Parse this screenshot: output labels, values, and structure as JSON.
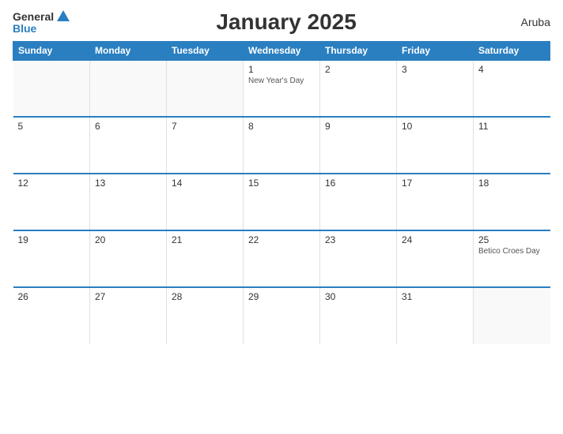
{
  "header": {
    "logo_general": "General",
    "logo_blue": "Blue",
    "title": "January 2025",
    "country": "Aruba"
  },
  "weekdays": [
    "Sunday",
    "Monday",
    "Tuesday",
    "Wednesday",
    "Thursday",
    "Friday",
    "Saturday"
  ],
  "weeks": [
    [
      {
        "day": "",
        "holiday": "",
        "empty": true
      },
      {
        "day": "",
        "holiday": "",
        "empty": true
      },
      {
        "day": "",
        "holiday": "",
        "empty": true
      },
      {
        "day": "1",
        "holiday": "New Year's Day",
        "empty": false
      },
      {
        "day": "2",
        "holiday": "",
        "empty": false
      },
      {
        "day": "3",
        "holiday": "",
        "empty": false
      },
      {
        "day": "4",
        "holiday": "",
        "empty": false
      }
    ],
    [
      {
        "day": "5",
        "holiday": "",
        "empty": false
      },
      {
        "day": "6",
        "holiday": "",
        "empty": false
      },
      {
        "day": "7",
        "holiday": "",
        "empty": false
      },
      {
        "day": "8",
        "holiday": "",
        "empty": false
      },
      {
        "day": "9",
        "holiday": "",
        "empty": false
      },
      {
        "day": "10",
        "holiday": "",
        "empty": false
      },
      {
        "day": "11",
        "holiday": "",
        "empty": false
      }
    ],
    [
      {
        "day": "12",
        "holiday": "",
        "empty": false
      },
      {
        "day": "13",
        "holiday": "",
        "empty": false
      },
      {
        "day": "14",
        "holiday": "",
        "empty": false
      },
      {
        "day": "15",
        "holiday": "",
        "empty": false
      },
      {
        "day": "16",
        "holiday": "",
        "empty": false
      },
      {
        "day": "17",
        "holiday": "",
        "empty": false
      },
      {
        "day": "18",
        "holiday": "",
        "empty": false
      }
    ],
    [
      {
        "day": "19",
        "holiday": "",
        "empty": false
      },
      {
        "day": "20",
        "holiday": "",
        "empty": false
      },
      {
        "day": "21",
        "holiday": "",
        "empty": false
      },
      {
        "day": "22",
        "holiday": "",
        "empty": false
      },
      {
        "day": "23",
        "holiday": "",
        "empty": false
      },
      {
        "day": "24",
        "holiday": "",
        "empty": false
      },
      {
        "day": "25",
        "holiday": "Betico Croes Day",
        "empty": false
      }
    ],
    [
      {
        "day": "26",
        "holiday": "",
        "empty": false
      },
      {
        "day": "27",
        "holiday": "",
        "empty": false
      },
      {
        "day": "28",
        "holiday": "",
        "empty": false
      },
      {
        "day": "29",
        "holiday": "",
        "empty": false
      },
      {
        "day": "30",
        "holiday": "",
        "empty": false
      },
      {
        "day": "31",
        "holiday": "",
        "empty": false
      },
      {
        "day": "",
        "holiday": "",
        "empty": true
      }
    ]
  ],
  "colors": {
    "header_bg": "#2a7fc1",
    "accent": "#2a7fc1"
  }
}
